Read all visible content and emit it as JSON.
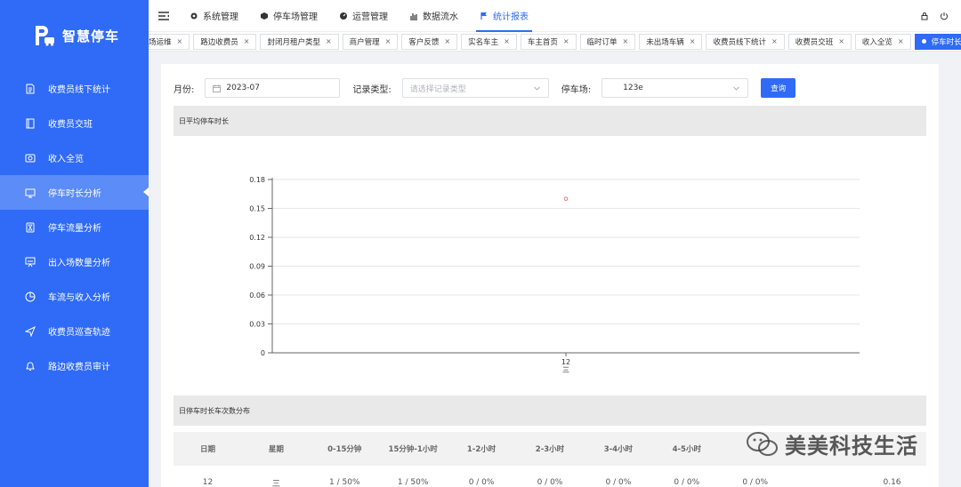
{
  "brand": {
    "name": "智慧停车",
    "logo_icon": "parking-car-logo"
  },
  "sidebar": {
    "items": [
      {
        "label": "收费员线下统计",
        "icon": "document-icon"
      },
      {
        "label": "收费员交班",
        "icon": "book-icon"
      },
      {
        "label": "收入全览",
        "icon": "money-icon"
      },
      {
        "label": "停车时长分析",
        "icon": "monitor-icon",
        "active": true
      },
      {
        "label": "停车流量分析",
        "icon": "hourglass-icon"
      },
      {
        "label": "出入场数量分析",
        "icon": "presentation-icon"
      },
      {
        "label": "车流与收入分析",
        "icon": "pie-icon"
      },
      {
        "label": "收费员巡查轨迹",
        "icon": "send-icon"
      },
      {
        "label": "路边收费员审计",
        "icon": "bell-icon"
      }
    ]
  },
  "topnav": {
    "items": [
      {
        "label": "系统管理",
        "icon": "gear-icon"
      },
      {
        "label": "停车场管理",
        "icon": "cube-icon"
      },
      {
        "label": "运营管理",
        "icon": "dashboard-icon"
      },
      {
        "label": "数据流水",
        "icon": "bars-icon"
      },
      {
        "label": "统计报表",
        "icon": "flag-icon",
        "active": true
      }
    ]
  },
  "tags": [
    "场运维",
    "路边收费员",
    "封闭月租户类型",
    "商户管理",
    "客户反馈",
    "实名车主",
    "车主首页",
    "临时订单",
    "未出场车辆",
    "收费员线下统计",
    "收费员交班",
    "收入全览",
    "停车时长分析"
  ],
  "filters": {
    "month_label": "月份:",
    "month_value": "2023-07",
    "record_type_label": "记录类型:",
    "record_type_placeholder": "请选择记录类型",
    "lot_label": "停车场:",
    "lot_value": "123e",
    "query_label": "查询"
  },
  "chart_section_title": "日平均停车时长",
  "chart_data": {
    "type": "scatter",
    "title": "",
    "xlabel": "",
    "ylabel": "",
    "categories": [
      "12\n三"
    ],
    "x_tick_line1": "12",
    "x_tick_line2": "三",
    "values": [
      0.16
    ],
    "ylim": [
      0,
      0.18
    ],
    "yticks": [
      "0",
      "0.03",
      "0.06",
      "0.09",
      "0.12",
      "0.15",
      "0.18"
    ],
    "grid": true,
    "point_color": "#e05a5a"
  },
  "table_section_title": "日停车时长车次数分布",
  "table": {
    "headers": [
      "日期",
      "星期",
      "0-15分钟",
      "15分钟-1小时",
      "1-2小时",
      "2-3小时",
      "3-4小时",
      "4-5小时",
      "",
      "",
      ""
    ],
    "rows": [
      [
        "12",
        "三",
        "1 / 50%",
        "1 / 50%",
        "0 / 0%",
        "0 / 0%",
        "0 / 0%",
        "0 / 0%",
        "0 / 0%",
        "",
        "0.16"
      ]
    ]
  },
  "watermark": "美美科技生活",
  "colors": {
    "primary": "#2f6bf6",
    "sidebar_active": "#5b8cf8"
  }
}
